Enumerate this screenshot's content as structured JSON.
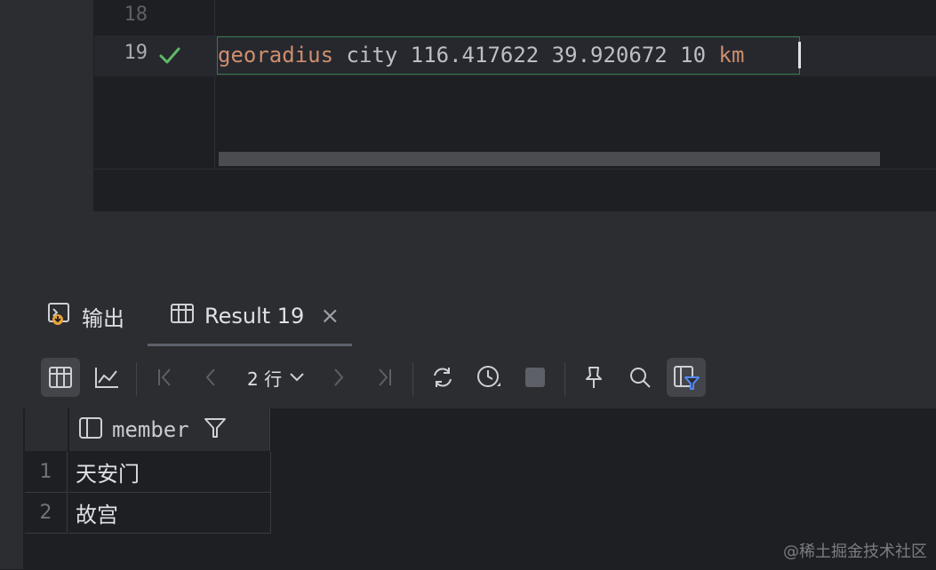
{
  "editor": {
    "line_numbers": [
      "18",
      "19"
    ],
    "status_icon": "check-icon",
    "code": {
      "keyword": "georadius",
      "rest": " city 116.417622 39.920672 10 ",
      "unit": "km"
    }
  },
  "tabs": [
    {
      "label": "输出",
      "icon": "output-icon"
    },
    {
      "label": "Result 19",
      "icon": "table-icon",
      "close": "×"
    }
  ],
  "toolbar": {
    "rows_label": "2 行",
    "icons": [
      "table-view-icon",
      "chart-view-icon",
      "first-page-icon",
      "prev-page-icon",
      "next-page-icon",
      "last-page-icon",
      "refresh-icon",
      "history-icon",
      "stop-icon",
      "pin-icon",
      "search-icon",
      "filter-icon"
    ]
  },
  "table": {
    "columns": [
      "member"
    ],
    "rows": [
      {
        "num": "1",
        "member": "天安门"
      },
      {
        "num": "2",
        "member": "故宫"
      }
    ]
  },
  "watermark": "@稀土掘金技术社区",
  "colors": {
    "keyword": "#cf8e6d",
    "check": "#5fb865",
    "accent_blue": "#548af7"
  }
}
